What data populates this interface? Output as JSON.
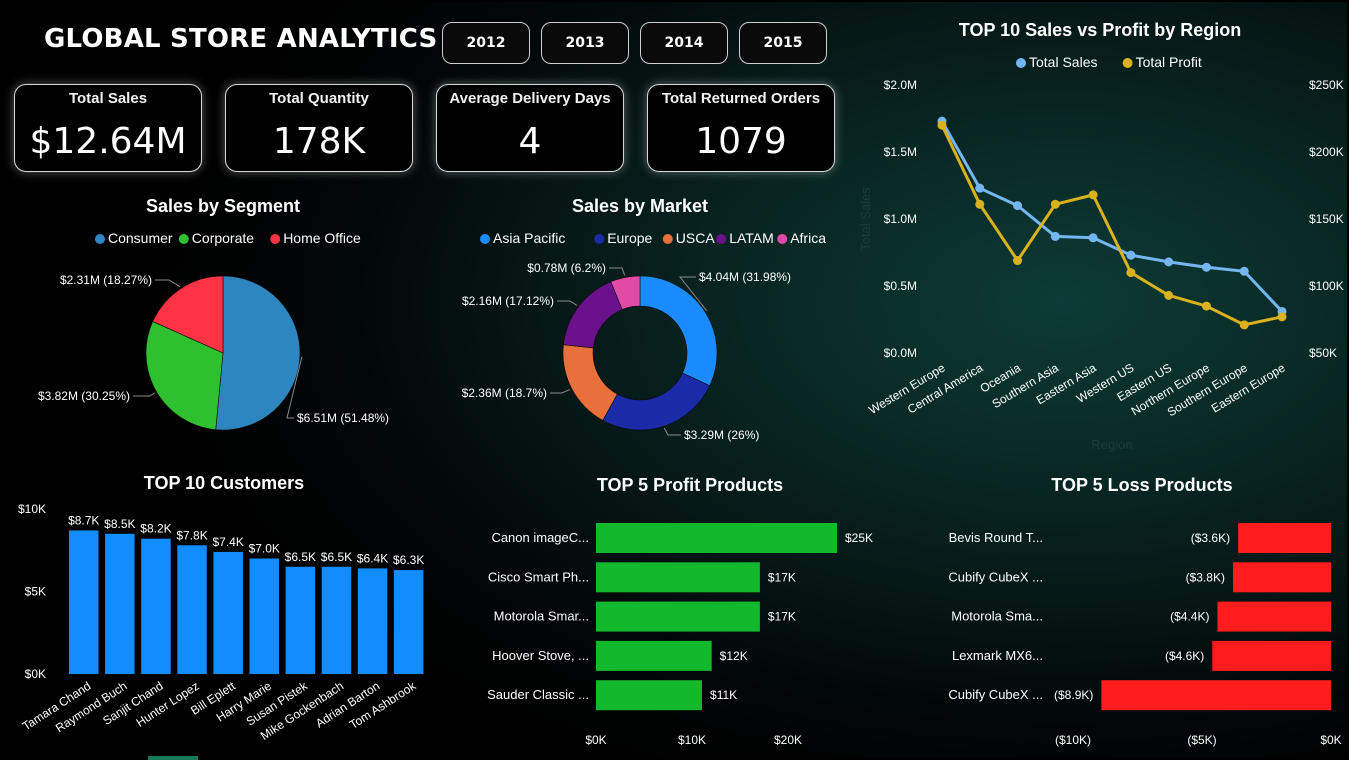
{
  "dashboard": {
    "title": "GLOBAL STORE ANALYTICS",
    "years": [
      "2012",
      "2013",
      "2014",
      "2015"
    ],
    "kpis": [
      {
        "label": "Total Sales",
        "value": "$12.64M"
      },
      {
        "label": "Total Quantity",
        "value": "178K"
      },
      {
        "label": "Average Delivery Days",
        "value": "4"
      },
      {
        "label": "Total Returned Orders",
        "value": "1079"
      }
    ]
  },
  "colors": {
    "sales_line": "#74b6f0",
    "profit_line": "#d9b21d",
    "customer_bar": "#118dff",
    "profit_bar": "#12b92c",
    "loss_bar": "#ff1c1c",
    "segment": [
      "#2e86c1",
      "#2ec02e",
      "#ff3344"
    ],
    "market": [
      "#1b8cff",
      "#1b2ba8",
      "#e8703a",
      "#6c118c",
      "#e24aa8"
    ]
  },
  "chart_data": [
    {
      "type": "pie",
      "title": "Sales by Segment",
      "legend": [
        "Consumer",
        "Corporate",
        "Home Office"
      ],
      "legend_position": "top",
      "values": [
        6.51,
        3.82,
        2.31
      ],
      "labels": [
        "$6.51M (51.48%)",
        "$3.82M (30.25%)",
        "$2.31M (18.27%)"
      ]
    },
    {
      "type": "pie",
      "title": "Sales by Market",
      "donut": true,
      "legend": [
        "Asia Pacific",
        "Europe",
        "USCA",
        "LATAM",
        "Africa"
      ],
      "legend_position": "top",
      "values": [
        4.04,
        3.29,
        2.36,
        2.16,
        0.78
      ],
      "labels": [
        "$4.04M (31.98%)",
        "$3.29M (26%)",
        "$2.36M (18.7%)",
        "$2.16M (17.12%)",
        "$0.78M (6.2%)"
      ]
    },
    {
      "type": "line",
      "title": "TOP 10 Sales vs Profit by Region",
      "xlabel": "Region",
      "ylabel": "Total Sales",
      "legend_position": "top",
      "categories": [
        "Western Europe",
        "Central America",
        "Oceania",
        "Southern Asia",
        "Eastern Asia",
        "Western US",
        "Eastern US",
        "Northern Europe",
        "Southern Europe",
        "Eastern Europe"
      ],
      "series": [
        {
          "name": "Total Sales",
          "axis": "left",
          "values": [
            1.73,
            1.23,
            1.1,
            0.87,
            0.86,
            0.73,
            0.68,
            0.64,
            0.61,
            0.31
          ]
        },
        {
          "name": "Total Profit",
          "axis": "right",
          "values": [
            220000,
            161000,
            119000,
            161000,
            168000,
            110000,
            93000,
            85000,
            71000,
            77000
          ]
        }
      ],
      "ylim": [
        0,
        2.0
      ],
      "y_ticks": [
        "$0.0M",
        "$0.5M",
        "$1.0M",
        "$1.5M",
        "$2.0M"
      ],
      "y2lim": [
        50000,
        250000
      ],
      "y2_ticks": [
        "$50K",
        "$100K",
        "$150K",
        "$200K",
        "$250K"
      ]
    },
    {
      "type": "bar",
      "title": "TOP 10 Customers",
      "categories": [
        "Tamara Chand",
        "Raymond Buch",
        "Sanjit Chand",
        "Hunter Lopez",
        "Bill Eplett",
        "Harry Marie",
        "Susan Pistek",
        "Mike Gockenbach",
        "Adrian Barton",
        "Tom Ashbrook"
      ],
      "values": [
        8.7,
        8.5,
        8.2,
        7.8,
        7.4,
        7.0,
        6.5,
        6.5,
        6.4,
        6.3
      ],
      "data_labels": [
        "$8.7K",
        "$8.5K",
        "$8.2K",
        "$7.8K",
        "$7.4K",
        "$7.0K",
        "$6.5K",
        "$6.5K",
        "$6.4K",
        "$6.3K"
      ],
      "ylim": [
        0,
        10
      ],
      "y_ticks": [
        "$0K",
        "$5K",
        "$10K"
      ]
    },
    {
      "type": "bar",
      "orientation": "horizontal",
      "title": "TOP 5 Profit Products",
      "categories": [
        "Canon imageC...",
        "Cisco Smart Ph...",
        "Motorola Smar...",
        "Hoover Stove, ...",
        "Sauder Classic ..."
      ],
      "values": [
        25,
        17,
        17,
        12,
        11
      ],
      "data_labels": [
        "$25K",
        "$17K",
        "$17K",
        "$12K",
        "$11K"
      ],
      "xlim": [
        0,
        25
      ],
      "x_ticks": [
        "$0K",
        "$10K",
        "$20K"
      ]
    },
    {
      "type": "bar",
      "orientation": "horizontal",
      "title": "TOP 5 Loss Products",
      "categories": [
        "Bevis Round T...",
        "Cubify CubeX ...",
        "Motorola Sma...",
        "Lexmark MX6...",
        "Cubify CubeX ..."
      ],
      "values": [
        -3.6,
        -3.8,
        -4.4,
        -4.6,
        -8.9
      ],
      "data_labels": [
        "($3.6K)",
        "($3.8K)",
        "($4.4K)",
        "($4.6K)",
        "($8.9K)"
      ],
      "xlim": [
        -10,
        0
      ],
      "x_ticks": [
        "($10K)",
        "($5K)",
        "$0K"
      ]
    }
  ]
}
